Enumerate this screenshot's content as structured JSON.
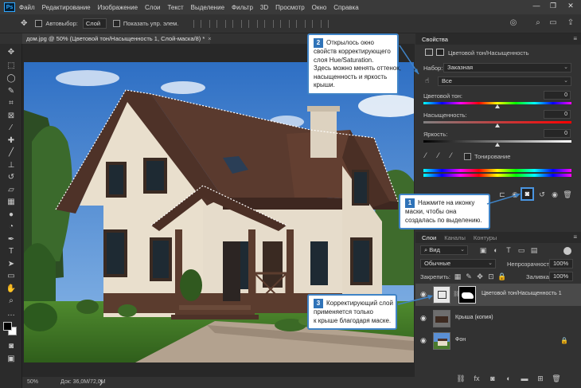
{
  "menu": [
    "Файл",
    "Редактирование",
    "Изображение",
    "Слои",
    "Текст",
    "Выделение",
    "Фильтр",
    "3D",
    "Просмотр",
    "Окно",
    "Справка"
  ],
  "app_logo": "Ps",
  "options": {
    "autoselect_label": "Автовыбор:",
    "autoselect_value": "Слой",
    "show_controls_label": "Показать упр. элем."
  },
  "document_tab": {
    "title": "дом.jpg @ 50% (Цветовой тон/Насыщенность 1, Слой-маска/8) *",
    "close": "×"
  },
  "status": {
    "zoom": "50%",
    "doc": "Док: 36,0M/72,0M"
  },
  "properties": {
    "tab": "Свойства",
    "layer_type": "Цветовой тон/Насыщенность",
    "preset_label": "Набор:",
    "preset_value": "Заказная",
    "channel_value": "Все",
    "hue_label": "Цветовой тон:",
    "hue_value": "0",
    "saturation_label": "Насыщенность:",
    "saturation_value": "0",
    "lightness_label": "Яркость:",
    "lightness_value": "0",
    "colorize_label": "Тонирование"
  },
  "layers_panel": {
    "tabs": [
      "Слои",
      "Каналы",
      "Контуры"
    ],
    "filter_value": "Вид",
    "blend_mode": "Обычные",
    "opacity_label": "Непрозрачность:",
    "opacity_value": "100%",
    "lock_label": "Закрепить:",
    "fill_label": "Заливка:",
    "fill_value": "100%",
    "layers": [
      {
        "name": "Цветовой тон/Насыщенность 1",
        "selected": true
      },
      {
        "name": "Крыша (копия)",
        "selected": false
      },
      {
        "name": "Фон",
        "selected": false
      }
    ]
  },
  "callouts": [
    {
      "number": "1",
      "lines": [
        "Нажмите на иконку",
        "маски, чтобы она",
        "создалась по выделению."
      ]
    },
    {
      "number": "2",
      "lines": [
        "Открылось окно",
        "свойств корректирующего",
        "слоя Hue/Saturation.",
        "Здесь можно менять оттенок,",
        "насыщенность и яркость",
        "крыши."
      ]
    },
    {
      "number": "3",
      "lines": [
        "Корректирующий слой",
        "применяется только",
        "к крыше благодаря маске."
      ]
    }
  ],
  "colors": {
    "accent": "#3f83c6",
    "badge": "#2f73b8",
    "panel": "#323232",
    "dark": "#282828"
  }
}
